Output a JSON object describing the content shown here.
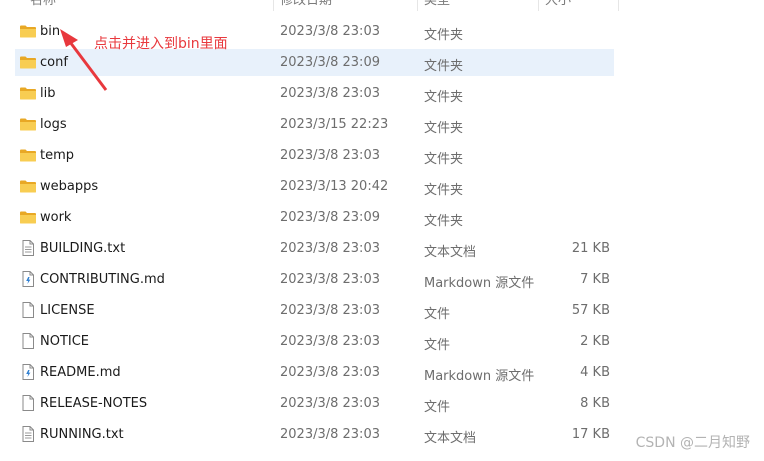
{
  "columns": {
    "name": "名称",
    "date": "修改日期",
    "type": "类型",
    "size": "大小"
  },
  "annotation": {
    "text": "点击并进入到bin里面",
    "color": "#e8383d"
  },
  "files": [
    {
      "name": "bin",
      "date": "2023/3/8 23:03",
      "type": "文件夹",
      "size": "",
      "icon": "folder-icon",
      "selected": false
    },
    {
      "name": "conf",
      "date": "2023/3/8 23:09",
      "type": "文件夹",
      "size": "",
      "icon": "folder-icon",
      "selected": true
    },
    {
      "name": "lib",
      "date": "2023/3/8 23:03",
      "type": "文件夹",
      "size": "",
      "icon": "folder-icon",
      "selected": false
    },
    {
      "name": "logs",
      "date": "2023/3/15 22:23",
      "type": "文件夹",
      "size": "",
      "icon": "folder-icon",
      "selected": false
    },
    {
      "name": "temp",
      "date": "2023/3/8 23:03",
      "type": "文件夹",
      "size": "",
      "icon": "folder-icon",
      "selected": false
    },
    {
      "name": "webapps",
      "date": "2023/3/13 20:42",
      "type": "文件夹",
      "size": "",
      "icon": "folder-icon",
      "selected": false
    },
    {
      "name": "work",
      "date": "2023/3/8 23:09",
      "type": "文件夹",
      "size": "",
      "icon": "folder-icon",
      "selected": false
    },
    {
      "name": "BUILDING.txt",
      "date": "2023/3/8 23:03",
      "type": "文本文档",
      "size": "21 KB",
      "icon": "text-file-icon",
      "selected": false
    },
    {
      "name": "CONTRIBUTING.md",
      "date": "2023/3/8 23:03",
      "type": "Markdown 源文件",
      "size": "7 KB",
      "icon": "markdown-file-icon",
      "selected": false
    },
    {
      "name": "LICENSE",
      "date": "2023/3/8 23:03",
      "type": "文件",
      "size": "57 KB",
      "icon": "file-icon",
      "selected": false
    },
    {
      "name": "NOTICE",
      "date": "2023/3/8 23:03",
      "type": "文件",
      "size": "2 KB",
      "icon": "file-icon",
      "selected": false
    },
    {
      "name": "README.md",
      "date": "2023/3/8 23:03",
      "type": "Markdown 源文件",
      "size": "4 KB",
      "icon": "markdown-file-icon",
      "selected": false
    },
    {
      "name": "RELEASE-NOTES",
      "date": "2023/3/8 23:03",
      "type": "文件",
      "size": "8 KB",
      "icon": "file-icon",
      "selected": false
    },
    {
      "name": "RUNNING.txt",
      "date": "2023/3/8 23:03",
      "type": "文本文档",
      "size": "17 KB",
      "icon": "text-file-icon",
      "selected": false
    }
  ],
  "watermark": "CSDN @二月知野",
  "colors": {
    "folder": "#f5c244",
    "selection": "#e8f1fb",
    "annotation": "#e8383d"
  }
}
